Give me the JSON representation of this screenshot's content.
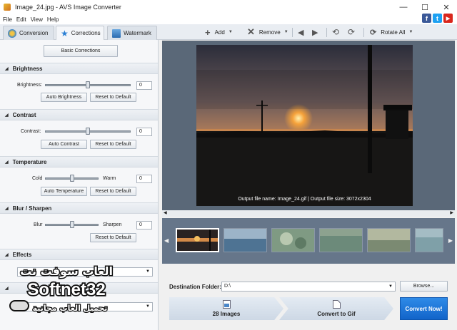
{
  "window": {
    "title": "Image_24.jpg - AVS Image Converter",
    "minimize": "—",
    "maximize": "☐",
    "close": "✕"
  },
  "menu": [
    {
      "label": "File"
    },
    {
      "label": "Edit"
    },
    {
      "label": "View"
    },
    {
      "label": "Help"
    }
  ],
  "social": {
    "facebook": "f",
    "twitter": "t",
    "youtube": "▶"
  },
  "tabs": [
    {
      "label": "Conversion",
      "icon": "conversion-icon"
    },
    {
      "label": "Corrections",
      "icon": "star-icon"
    },
    {
      "label": "Watermark",
      "icon": "image-icon"
    }
  ],
  "toolbar": {
    "add": "Add",
    "remove": "Remove",
    "rotate_all": "Rotate All"
  },
  "corrections": {
    "basic_button": "Basic Corrections",
    "brightness": {
      "title": "Brightness",
      "label": "Brightness:",
      "value": "0",
      "auto": "Auto Brightness",
      "reset": "Reset to Default",
      "level": 0.5
    },
    "contrast": {
      "title": "Contrast",
      "label": "Contrast:",
      "value": "0",
      "auto": "Auto Contrast",
      "reset": "Reset to Default",
      "level": 0.5
    },
    "temperature": {
      "title": "Temperature",
      "left": "Cold",
      "right": "Warm",
      "value": "0",
      "auto": "Auto Temperature",
      "reset": "Reset to Default",
      "level": 0.5
    },
    "blur": {
      "title": "Blur / Sharpen",
      "left": "Blur",
      "right": "Sharpen",
      "value": "0",
      "reset": "Reset to Default",
      "level": 0.5
    },
    "effects": {
      "title": "Effects"
    }
  },
  "preview": {
    "output_info": "Output file name: Image_24.gif | Output file size: 3072x2304"
  },
  "bottom": {
    "destination_label": "Destination Folder:",
    "destination_value": "D:\\",
    "browse": "Browse...",
    "step1": "28 Images",
    "step2": "Convert to Gif",
    "convert": "Convert Now!"
  },
  "watermark_overlay": {
    "line1": "العاب سوفت نت",
    "line2": "Softnet32",
    "line3": "تحميل العاب مجانية"
  },
  "colors": {
    "accent": "#1b74d9",
    "preview_bg": "#5a6878",
    "strip_bg": "#66768a"
  }
}
